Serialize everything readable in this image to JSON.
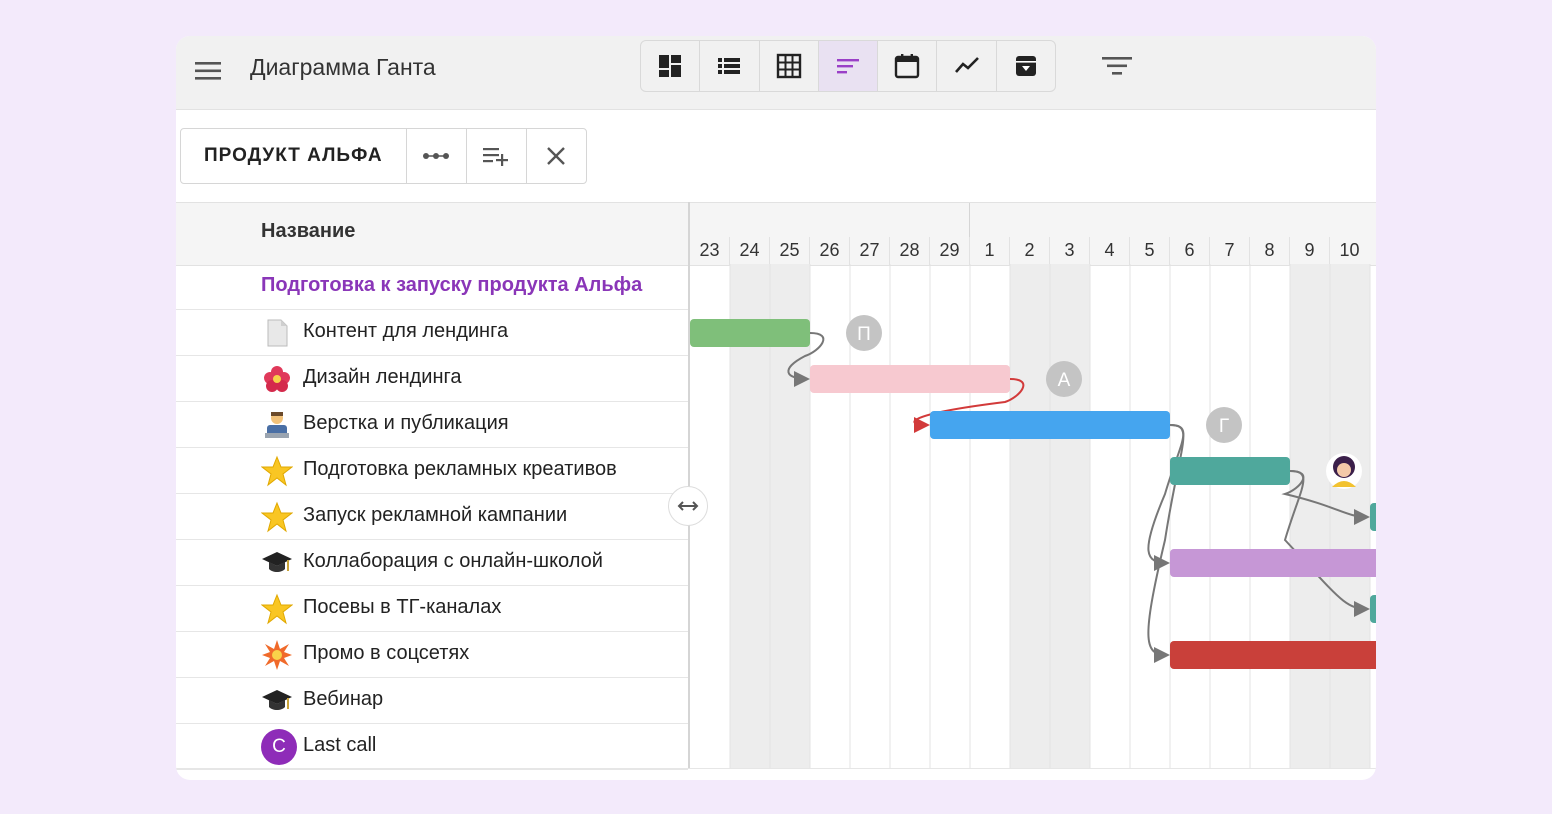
{
  "app": {
    "title": "Диаграмма Ганта"
  },
  "toolbar": {
    "views": [
      {
        "icon": "dashboard-icon"
      },
      {
        "icon": "list-icon"
      },
      {
        "icon": "table-icon"
      },
      {
        "icon": "gantt-icon",
        "active": true
      },
      {
        "icon": "calendar-icon"
      },
      {
        "icon": "chart-icon"
      },
      {
        "icon": "archive-icon"
      }
    ],
    "filter_icon": "filter-icon"
  },
  "project": {
    "name": "ПРОДУКТ АЛЬФА",
    "buttons": [
      "more-icon",
      "add-row-icon",
      "close-icon"
    ]
  },
  "list": {
    "column_title": "Название",
    "rows": [
      {
        "label": "Подготовка к запуску продукта Альфа",
        "type": "group"
      },
      {
        "label": "Контент для лендинга",
        "icon": "document-icon"
      },
      {
        "label": "Дизайн лендинга",
        "icon": "flower-icon"
      },
      {
        "label": "Верстка и публикация",
        "icon": "technologist-icon"
      },
      {
        "label": "Подготовка рекламных креативов",
        "icon": "star-icon"
      },
      {
        "label": "Запуск рекламной кампании",
        "icon": "star-icon"
      },
      {
        "label": "Коллаборация с онлайн-школой",
        "icon": "graduation-cap-icon"
      },
      {
        "label": "Посевы в ТГ-каналах",
        "icon": "star-icon"
      },
      {
        "label": "Промо в соцсетях",
        "icon": "explosion-icon"
      },
      {
        "label": "Вебинар",
        "icon": "graduation-cap-icon"
      },
      {
        "label": "Last call",
        "avatar": "C"
      }
    ]
  },
  "timeline": {
    "days": [
      "23",
      "24",
      "25",
      "26",
      "27",
      "28",
      "29",
      "1",
      "2",
      "3",
      "4",
      "5",
      "6",
      "7",
      "8",
      "9",
      "10"
    ],
    "weekend_day_indices": [
      1,
      2,
      8,
      9,
      15,
      16
    ],
    "bars": [
      {
        "row": 1,
        "start": 0,
        "end": 3,
        "color": "#7fbf7a",
        "assignee": "П"
      },
      {
        "row": 2,
        "start": 3,
        "end": 8,
        "color": "#f7c9d0",
        "assignee": "А"
      },
      {
        "row": 3,
        "start": 6,
        "end": 12,
        "color": "#45a5ef",
        "assignee": "Г"
      },
      {
        "row": 4,
        "start": 12,
        "end": 15,
        "color": "#4fa89c",
        "assignee_avatar": "woman-avatar"
      },
      {
        "row": 5,
        "start": 17,
        "end": 18,
        "color": "#4fa89c"
      },
      {
        "row": 6,
        "start": 12,
        "end": 18,
        "color": "#c697d6"
      },
      {
        "row": 7,
        "start": 17,
        "end": 18,
        "color": "#4fa89c"
      },
      {
        "row": 8,
        "start": 12,
        "end": 18,
        "color": "#c9403a"
      }
    ]
  }
}
